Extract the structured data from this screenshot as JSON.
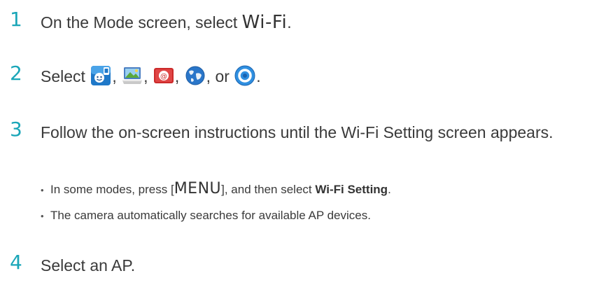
{
  "steps": [
    {
      "number": "1",
      "prefix": "On the Mode screen, select ",
      "keyword": "Wi-Fi",
      "suffix": "."
    },
    {
      "number": "2",
      "prefix": "Select ",
      "icons": [
        "mobilelink-icon",
        "remote-viewfinder-icon",
        "email-icon",
        "sns-cloud-icon",
        "allshare-play-icon"
      ],
      "sep1": ",",
      "sep2": ",",
      "sep3": ",",
      "sep4": ", or",
      "suffix": "."
    },
    {
      "number": "3",
      "text": "Follow the on-screen instructions until the Wi-Fi Setting screen appears.",
      "bullets": [
        {
          "prefix": "In some modes, press [",
          "key": "MENU",
          "middle": "], and then select ",
          "bold": "Wi-Fi Setting",
          "suffix": "."
        },
        {
          "text": "The camera automatically searches for available AP devices."
        }
      ]
    },
    {
      "number": "4",
      "text": "Select an AP."
    }
  ],
  "colors": {
    "accent": "#1aa6b8",
    "text": "#3a3a3a"
  }
}
